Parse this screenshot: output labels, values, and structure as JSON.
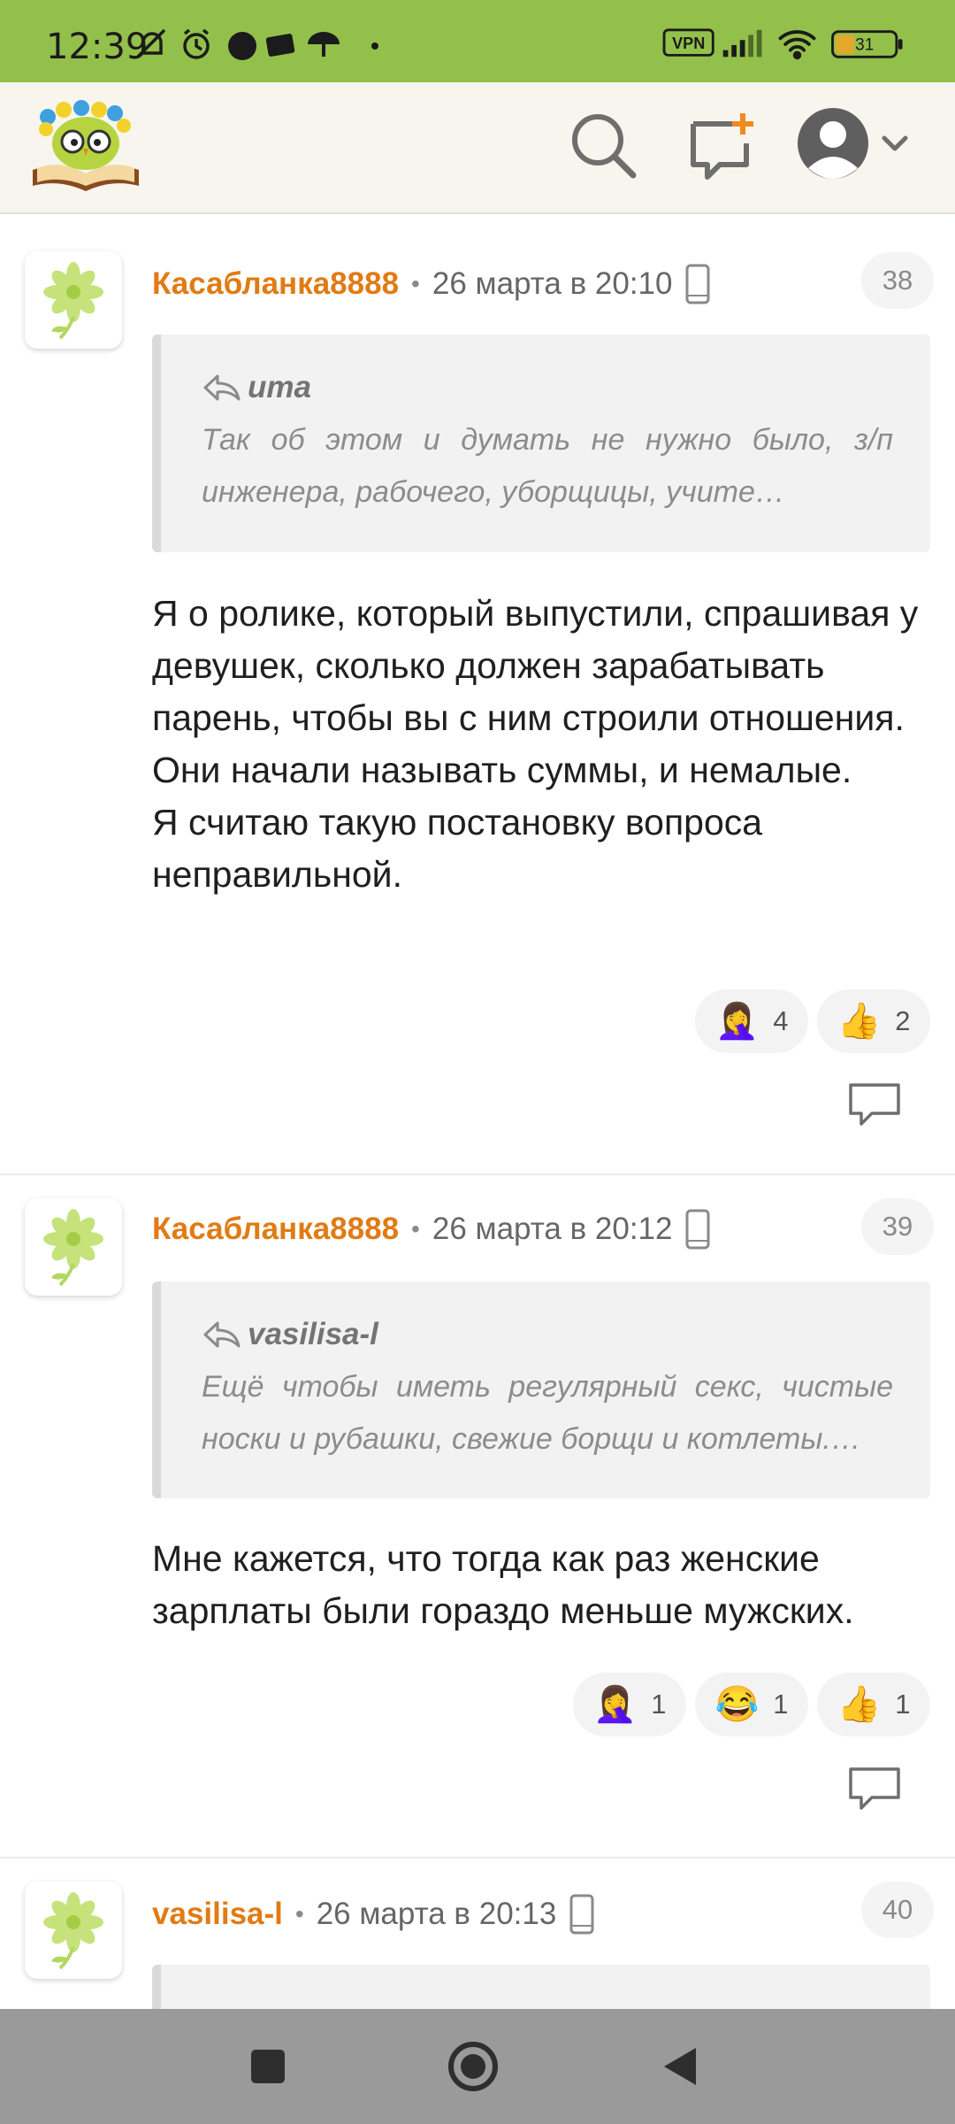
{
  "status_bar": {
    "time": "12:39",
    "vpn": "VPN",
    "battery": "31",
    "icons": [
      "mute-icon",
      "alarm-icon",
      "circle-icon",
      "photo-icon",
      "umbrella-icon",
      "dot-icon",
      "signal-icon",
      "wifi-icon",
      "battery-icon"
    ]
  },
  "header": {
    "logo": "book-owl-logo",
    "icons": [
      "search-icon",
      "new-message-icon",
      "profile-icon",
      "chevron-down-icon"
    ]
  },
  "comments": [
    {
      "author": "Касабланка8888",
      "date": "26 марта в 20:10",
      "number": "38",
      "quote_author": "uma",
      "quote_text": "Так об этом и думать не нужно было, з/п инженера, рабочего, уборщицы, учите…",
      "text": "Я о ролике, который выпустили, спрашивая у девушек, сколько должен зарабатывать парень, чтобы вы с ним строили отношения. Они начали называть суммы, и немалые.\nЯ считаю такую постановку вопроса неправильной.",
      "reactions": [
        {
          "emoji": "🤦‍♀️",
          "count": "4"
        },
        {
          "emoji": "👍",
          "count": "2"
        }
      ]
    },
    {
      "author": "Касабланка8888",
      "date": "26 марта в 20:12",
      "number": "39",
      "quote_author": "vasilisa-l",
      "quote_text": "Ещё чтобы иметь регулярный секс, чистые носки и рубашки, свежие борщи и котлеты.…",
      "text": "Мне кажется, что тогда как раз женские зарплаты были гораздо меньше мужских.",
      "reactions": [
        {
          "emoji": "🤦‍♀️",
          "count": "1"
        },
        {
          "emoji": "😂",
          "count": "1"
        },
        {
          "emoji": "👍",
          "count": "1"
        }
      ]
    },
    {
      "author": "vasilisa-l",
      "date": "26 марта в 20:13",
      "number": "40"
    }
  ],
  "nav": {
    "icons": [
      "recents-icon",
      "home-icon",
      "back-icon"
    ]
  }
}
